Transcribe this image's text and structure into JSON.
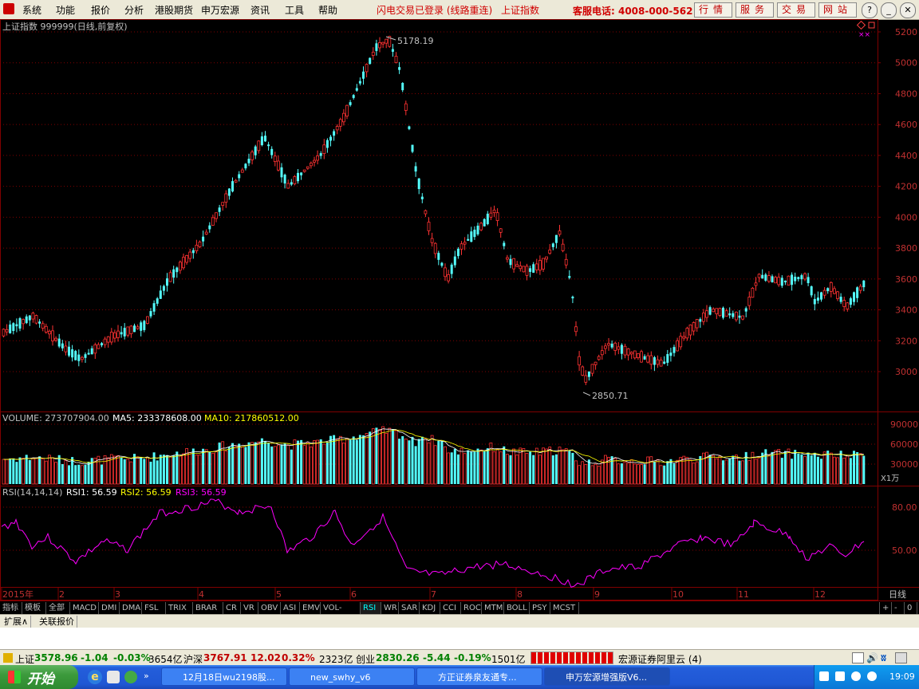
{
  "menu": [
    "系统",
    "功能",
    "报价",
    "分析",
    "港股期货",
    "申万宏源",
    "资讯",
    "工具",
    "帮助"
  ],
  "status": {
    "login": "闪电交易已登录 (线路重连)",
    "index": "上证指数"
  },
  "hotline": "客服电话: 4008-000-562",
  "top_buttons": [
    "行情",
    "服务",
    "交易",
    "网站"
  ],
  "window_buttons": [
    "?",
    "_",
    "▭",
    "✕"
  ],
  "chart": {
    "title": "上证指数 999999(日线,前复权)",
    "high_label": "5178.19",
    "low_label": "2850.71",
    "price_ticks": [
      "5200",
      "5000",
      "4800",
      "4600",
      "4400",
      "4200",
      "4000",
      "3800",
      "3600",
      "3400",
      "3200",
      "3000"
    ],
    "volume": {
      "label": "VOLUME: 273707904.00",
      "ma5": "MA5: 233378608.00",
      "ma10": "MA10: 217860512.00",
      "ticks": [
        "90000",
        "60000",
        "30000"
      ],
      "unit": "X1万"
    },
    "rsi": {
      "label": "RSI(14,14,14)",
      "rsi1": "RSI1: 56.59",
      "rsi2": "RSI2: 56.59",
      "rsi3": "RSI3: 56.59",
      "ticks": [
        "80.00",
        "50.00"
      ]
    },
    "x_labels": [
      "2015年",
      "2",
      "3",
      "4",
      "5",
      "6",
      "7",
      "8",
      "9",
      "10",
      "11",
      "12"
    ],
    "period": "日线",
    "colors": {
      "up": "#ff3232",
      "down": "#54fcfc",
      "grid": "#800000",
      "ma5": "#ffffff",
      "ma10": "#ffff00",
      "rsi": "#ff00ff"
    }
  },
  "indicator_tabs": [
    "指标",
    "模板",
    "全部",
    "MACD",
    "DMI",
    "DMA",
    "FSL",
    "TRIX",
    "BRAR",
    "CR",
    "VR",
    "OBV",
    "ASI",
    "EMV",
    "VOL-TDX",
    "RSI",
    "WR",
    "SAR",
    "KDJ",
    "CCI",
    "ROC",
    "MTM",
    "BOLL",
    "PSY",
    "MCST"
  ],
  "active_indicator": "RSI",
  "zoom_buttons": [
    "+",
    "-",
    "0"
  ],
  "expand_tabs": [
    "扩展∧",
    "关联报价"
  ],
  "ticker": {
    "sh_name": "上证",
    "sh_price": "3578.96",
    "sh_chg": "-1.04",
    "sh_pct": "-0.03%",
    "sh_amt": "3654亿",
    "hs_name": "沪深",
    "hs_price": "3767.91",
    "hs_chg": "12.02",
    "hs_pct": "0.32%",
    "hs_amt": "2323亿",
    "cy_name": "创业",
    "cy_price": "2830.26",
    "cy_chg": "-5.44",
    "cy_pct": "-0.19%",
    "cy_amt": "1501亿",
    "broker": "宏源证券阿里云 (4)"
  },
  "taskbar": {
    "start": "开始",
    "tasks": [
      "12月18日wu2198股...",
      "new_swhy_v6",
      "方正证券泉友通专...",
      "申万宏源增强版V6..."
    ],
    "active_task": 3,
    "clock": "19:09"
  }
}
